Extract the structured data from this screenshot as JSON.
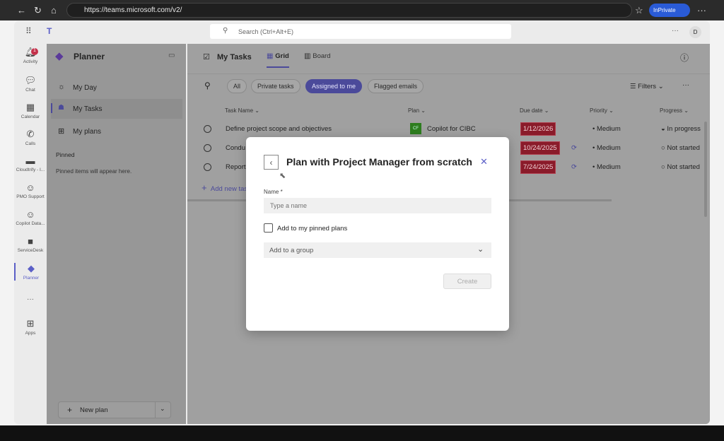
{
  "browser": {
    "url": "https://teams.microsoft.com/v2/",
    "inprivate": "InPrivate"
  },
  "topbar": {
    "search_placeholder": "Search (Ctrl+Alt+E)",
    "avatar": "D",
    "more": "···"
  },
  "rail": [
    {
      "label": "Activity",
      "icon": "bell-icon",
      "badge": "1"
    },
    {
      "label": "Chat",
      "icon": "chat-icon"
    },
    {
      "label": "Calendar",
      "icon": "calendar-icon"
    },
    {
      "label": "Calls",
      "icon": "phone-icon"
    },
    {
      "label": "Cloudtrify - I...",
      "icon": "app-icon"
    },
    {
      "label": "PMO Support",
      "icon": "bot-icon"
    },
    {
      "label": "Copilot Data...",
      "icon": "bot-icon"
    },
    {
      "label": "ServiceDesk",
      "icon": "app-icon"
    },
    {
      "label": "Planner",
      "icon": "planner-icon"
    },
    {
      "label": "···",
      "icon": "more-icon"
    },
    {
      "label": "Apps",
      "icon": "plus-icon"
    }
  ],
  "sidebar": {
    "title": "Planner",
    "items": [
      {
        "label": "My Day"
      },
      {
        "label": "My Tasks"
      },
      {
        "label": "My plans"
      }
    ],
    "pinned_title": "Pinned",
    "pinned_empty": "Pinned items will appear here.",
    "new_plan": "New plan"
  },
  "main": {
    "title": "My Tasks",
    "tabs": [
      "Grid",
      "Board"
    ],
    "chips": [
      "All",
      "Private tasks",
      "Assigned to me",
      "Flagged emails"
    ],
    "filters": "Filters",
    "columns": [
      "Task Name",
      "Plan",
      "Due date",
      "Priority",
      "Progress"
    ],
    "rows": [
      {
        "name": "Define project scope and objectives",
        "plan": "Copilot for CIBC",
        "plan_abbr": "CF",
        "due": "1/12/2026",
        "priority": "Medium",
        "progress": "In progress"
      },
      {
        "name": "Condu",
        "plan": "",
        "due": "10/24/2025",
        "priority": "Medium",
        "progress": "Not started"
      },
      {
        "name": "Report",
        "plan": "",
        "due": "7/24/2025",
        "priority": "Medium",
        "progress": "Not started"
      }
    ],
    "add_task": "Add new task"
  },
  "modal": {
    "title": "Plan with Project Manager from scratch",
    "name_label": "Name *",
    "name_placeholder": "Type a name",
    "pinned_label": "Add to my pinned plans",
    "group_placeholder": "Add to a group",
    "create": "Create"
  }
}
